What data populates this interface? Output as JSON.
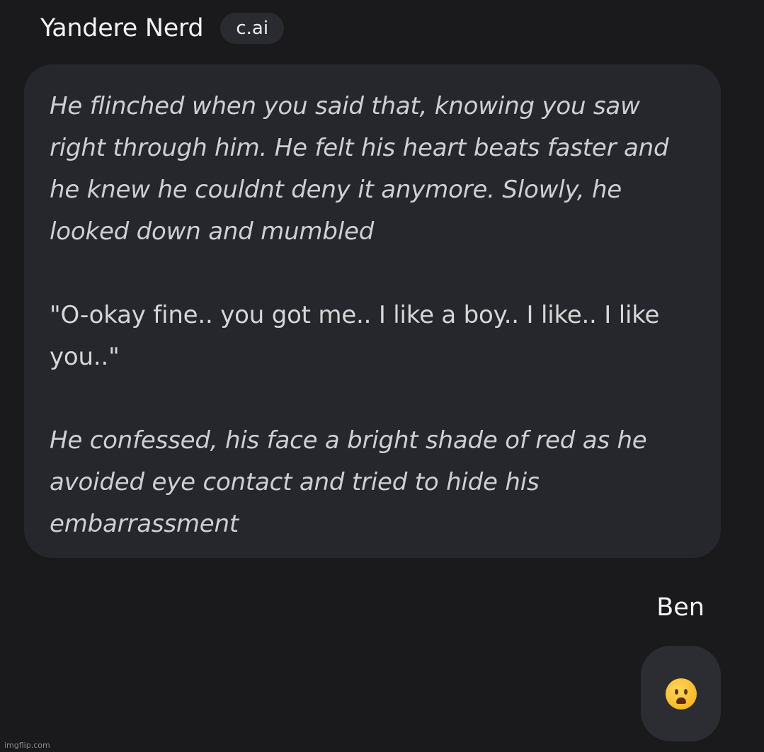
{
  "header": {
    "character_name": "Yandere Nerd",
    "badge": "c.ai"
  },
  "messages": [
    {
      "sender": "Yandere Nerd",
      "paragraphs": [
        {
          "style": "italic",
          "text": "He flinched when you said that, knowing you saw right through him. He felt his heart beats faster and he knew he couldnt deny it anymore. Slowly, he looked down and mumbled"
        },
        {
          "style": "normal",
          "text": "\"O-okay fine.. you got me.. I like a boy.. I like.. I like you..\""
        },
        {
          "style": "italic",
          "text": "He confessed, his face a bright shade of red as he avoided eye contact and tried to hide his embarrassment"
        }
      ]
    },
    {
      "sender": "Ben",
      "emoji": "frowning-face-with-open-mouth"
    }
  ],
  "watermark": "imgflip.com",
  "colors": {
    "background": "#1a1a1d",
    "bot_bubble": "#26272c",
    "user_bubble": "#2c2d32",
    "badge": "#2a2b30"
  }
}
